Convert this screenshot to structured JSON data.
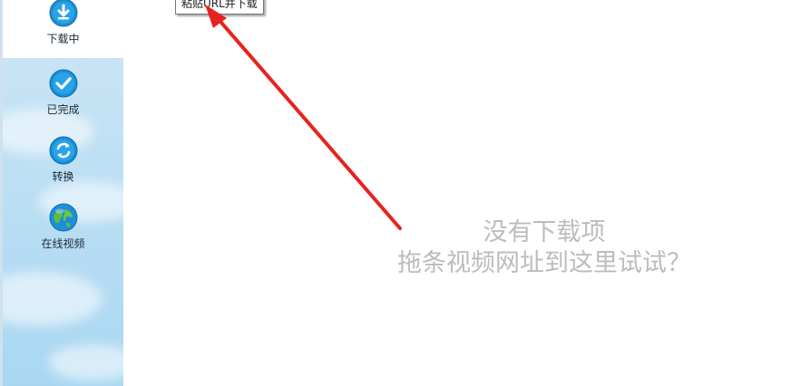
{
  "sidebar": {
    "items": [
      {
        "label": "下载中",
        "icon": "download-icon"
      },
      {
        "label": "已完成",
        "icon": "check-icon"
      },
      {
        "label": "转换",
        "icon": "convert-icon"
      },
      {
        "label": "在线视频",
        "icon": "globe-icon"
      }
    ]
  },
  "tooltip": {
    "text": "粘贴URL并下载"
  },
  "empty_state": {
    "line1": "没有下载项",
    "line2": "拖条视频网址到这里试试？"
  },
  "colors": {
    "accent": "#1a8fd6",
    "arrow": "#e8221f",
    "empty_text": "#bcbcbc"
  }
}
